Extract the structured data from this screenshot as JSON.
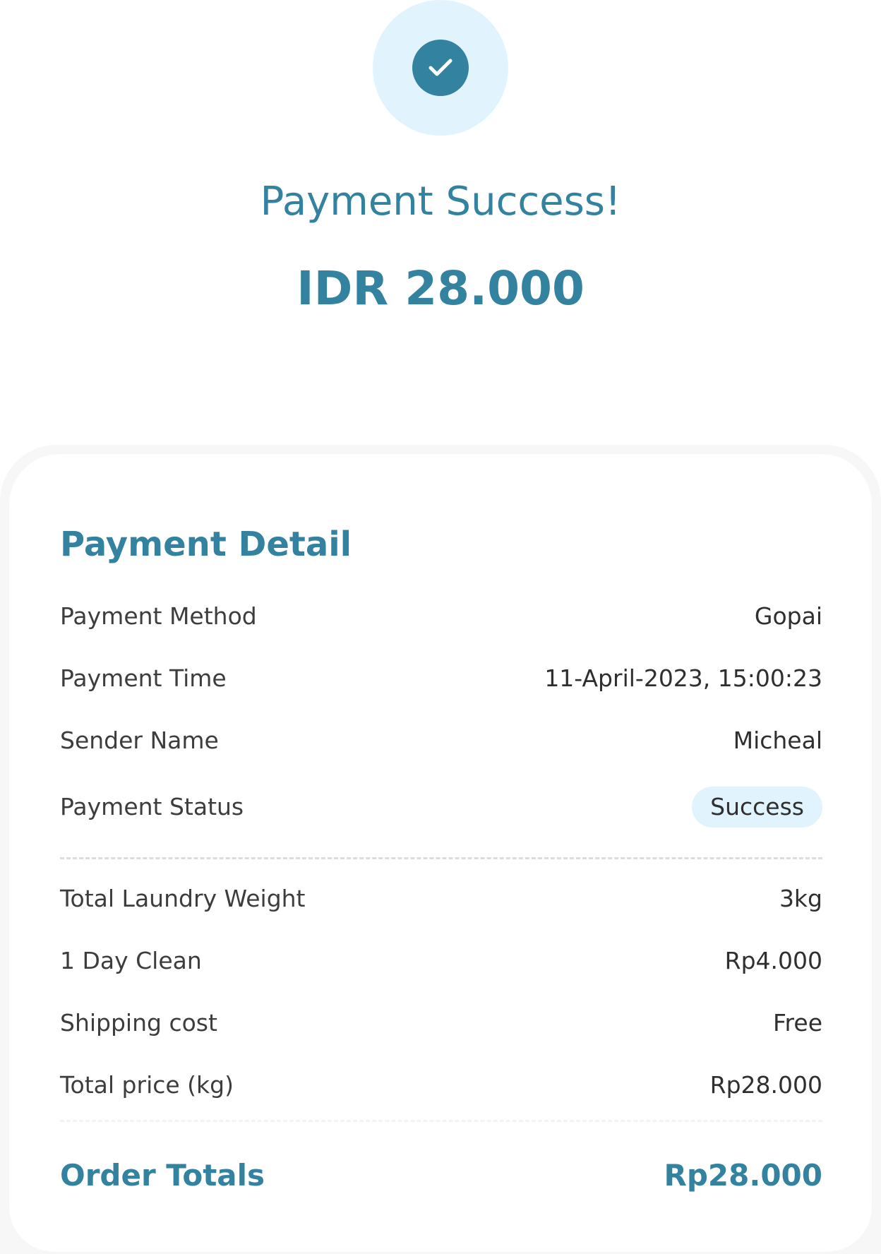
{
  "header": {
    "title": "Payment Success!",
    "amount": "IDR 28.000",
    "icon": "check-icon"
  },
  "detail": {
    "title": "Payment Detail",
    "rows": [
      {
        "label": "Payment Method",
        "value": "Gopai"
      },
      {
        "label": "Payment Time",
        "value": "11-April-2023, 15:00:23"
      },
      {
        "label": "Sender Name",
        "value": "Micheal"
      },
      {
        "label": "Payment Status",
        "value": "Success"
      }
    ],
    "cost_rows": [
      {
        "label": "Total Laundry Weight",
        "value": "3kg"
      },
      {
        "label": "1 Day Clean",
        "value": "Rp4.000"
      },
      {
        "label": "Shipping cost",
        "value": "Free"
      },
      {
        "label": "Total price (kg)",
        "value": "Rp28.000"
      }
    ],
    "total_label": "Order Totals",
    "total_value": "Rp28.000"
  },
  "colors": {
    "accent": "#33829f",
    "halo": "#e1f4fd",
    "badge": "#e1f4fd"
  }
}
